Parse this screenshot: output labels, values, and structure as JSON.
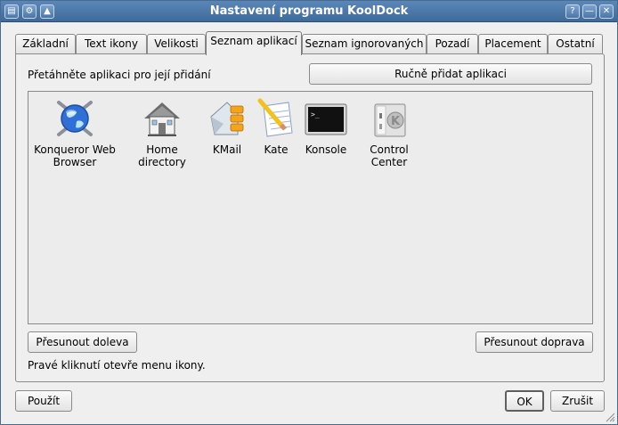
{
  "window": {
    "title": "Nastavení programu KoolDock",
    "left_buttons": [
      "▤",
      "⚙",
      "▲"
    ],
    "right_buttons": [
      "?",
      "—",
      "✕"
    ]
  },
  "tabs": [
    {
      "label": "Základní",
      "active": false
    },
    {
      "label": "Text ikony",
      "active": false
    },
    {
      "label": "Velikosti",
      "active": false
    },
    {
      "label": "Seznam aplikací",
      "active": true
    },
    {
      "label": "Seznam ignorovaných",
      "active": false
    },
    {
      "label": "Pozadí",
      "active": false
    },
    {
      "label": "Placement",
      "active": false
    },
    {
      "label": "Ostatní",
      "active": false
    }
  ],
  "panel": {
    "hint": "Přetáhněte aplikaci pro její přidání",
    "add_manually_label": "Ručně přidat aplikaci",
    "apps": [
      {
        "label": "Konqueror Web Browser",
        "icon": "konqueror-globe-icon"
      },
      {
        "label": "Home directory",
        "icon": "home-house-icon"
      },
      {
        "label": "KMail",
        "icon": "kmail-envelope-icon"
      },
      {
        "label": "Kate",
        "icon": "kate-notepad-icon"
      },
      {
        "label": "Konsole",
        "icon": "konsole-terminal-icon"
      },
      {
        "label": "Control Center",
        "icon": "control-center-icon"
      }
    ],
    "move_left_label": "Přesunout doleva",
    "move_right_label": "Přesunout doprava",
    "status": "Pravé kliknutí otevře menu ikony."
  },
  "footer": {
    "apply_label": "Použít",
    "ok_label": "OK",
    "cancel_label": "Zrušit"
  }
}
